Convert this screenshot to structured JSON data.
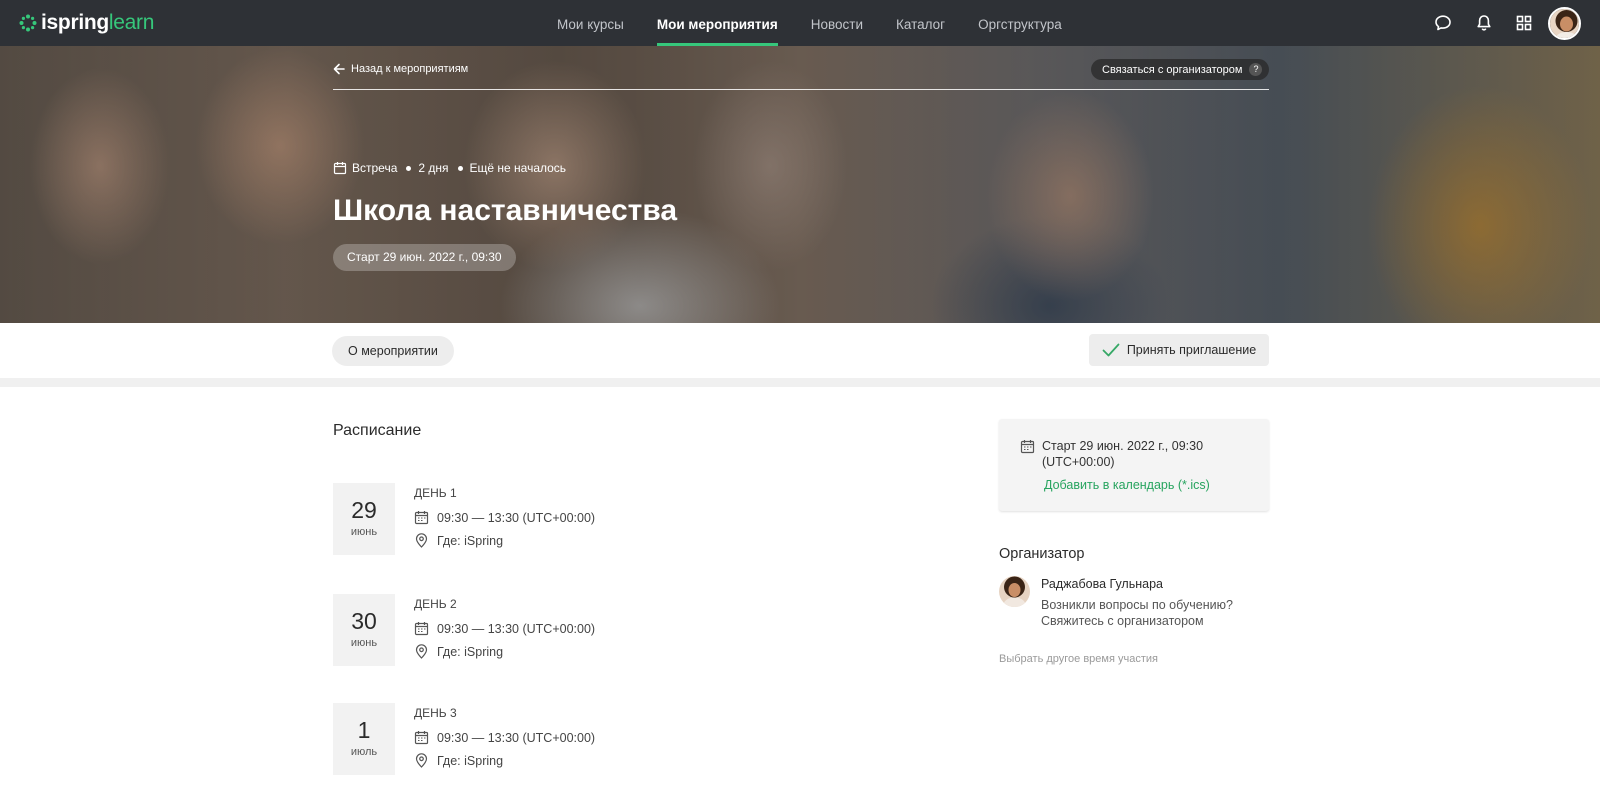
{
  "brand": {
    "name_part1": "ispring",
    "name_part2": "learn",
    "accent": "#36c77b"
  },
  "nav": {
    "items": [
      {
        "label": "Мои курсы",
        "active": false
      },
      {
        "label": "Мои мероприятия",
        "active": true
      },
      {
        "label": "Новости",
        "active": false
      },
      {
        "label": "Каталог",
        "active": false
      },
      {
        "label": "Оргструктура",
        "active": false
      }
    ],
    "icons": [
      "chat-icon",
      "bell-icon",
      "apps-grid-icon",
      "user-avatar"
    ]
  },
  "hero": {
    "back_label": "Назад к мероприятиям",
    "contact_label": "Связаться с организатором",
    "contact_help": "?",
    "meta": {
      "type": "Встреча",
      "duration": "2 дня",
      "status": "Ещё не началось"
    },
    "title": "Школа наставничества",
    "start": "Старт 29 июн. 2022 г., 09:30"
  },
  "actions": {
    "about_tab": "О мероприятии",
    "accept_label": "Принять приглашение"
  },
  "schedule": {
    "title": "Расписание",
    "days": [
      {
        "day": "29",
        "month": "июнь",
        "label": "ДЕНЬ 1",
        "time": "09:30 — 13:30 (UTC+00:00)",
        "place": "Где: iSpring"
      },
      {
        "day": "30",
        "month": "июнь",
        "label": "ДЕНЬ 2",
        "time": "09:30 — 13:30 (UTC+00:00)",
        "place": "Где: iSpring"
      },
      {
        "day": "1",
        "month": "июль",
        "label": "ДЕНЬ 3",
        "time": "09:30 — 13:30 (UTC+00:00)",
        "place": "Где: iSpring"
      }
    ]
  },
  "sidebar": {
    "start_text": "Старт 29 июн. 2022 г., 09:30 (UTC+00:00)",
    "add_calendar": "Добавить в календарь (*.ics)",
    "organizer_title": "Организатор",
    "organizer_name": "Раджабова Гульнара",
    "organizer_q1": "Возникли вопросы по обучению?",
    "organizer_q2": "Свяжитесь с организатором",
    "other_time": "Выбрать другое время участия"
  }
}
